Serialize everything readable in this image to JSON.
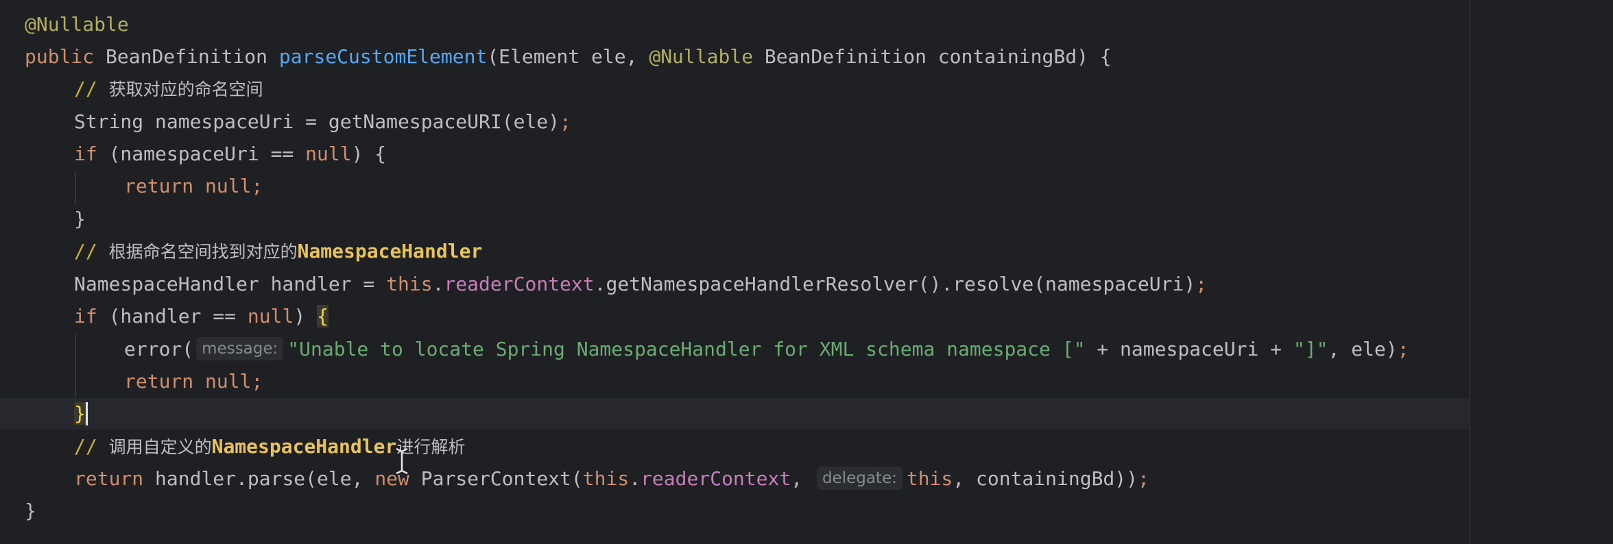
{
  "editor": {
    "lines": [
      {
        "id": "annotation",
        "segments": [
          {
            "t": "@Nullable",
            "c": "ann"
          }
        ]
      },
      {
        "id": "method-signature",
        "segments": [
          {
            "t": "public ",
            "c": "kw"
          },
          {
            "t": "BeanDefinition ",
            "c": ""
          },
          {
            "t": "parseCustomElement",
            "c": "fn"
          },
          {
            "t": "(Element ele, ",
            "c": ""
          },
          {
            "t": "@Nullable ",
            "c": "ann"
          },
          {
            "t": "BeanDefinition containingBd) {",
            "c": ""
          }
        ]
      },
      {
        "id": "comment-get-namespace",
        "segments": [
          {
            "t": "// ",
            "c": "cmt-mark"
          },
          {
            "t": "获取对应的命名空间",
            "c": "cmt-txt"
          }
        ]
      },
      {
        "id": "namespace-uri-decl",
        "segments": [
          {
            "t": "String namespaceUri = getNamespaceURI(ele)",
            "c": ""
          },
          {
            "t": ";",
            "c": "kw"
          }
        ]
      },
      {
        "id": "if-namespace-null",
        "segments": [
          {
            "t": "if ",
            "c": "kw"
          },
          {
            "t": "(namespaceUri == ",
            "c": ""
          },
          {
            "t": "null",
            "c": "kw"
          },
          {
            "t": ") {",
            "c": ""
          }
        ]
      },
      {
        "id": "return-null-1",
        "segments": [
          {
            "t": "return null;",
            "c": "kw"
          }
        ]
      },
      {
        "id": "close-brace-1",
        "segments": [
          {
            "t": "}",
            "c": ""
          }
        ]
      },
      {
        "id": "comment-find-handler",
        "segments": [
          {
            "t": "// ",
            "c": "cmt-mark"
          },
          {
            "t": "根据命名空间找到对应的",
            "c": "cmt-txt"
          },
          {
            "t": "NamespaceHandler",
            "c": "cmt-bold"
          }
        ]
      },
      {
        "id": "handler-decl",
        "segments": [
          {
            "t": "NamespaceHandler handler = ",
            "c": ""
          },
          {
            "t": "this",
            "c": "kw"
          },
          {
            "t": ".",
            "c": ""
          },
          {
            "t": "readerContext",
            "c": "fld"
          },
          {
            "t": ".getNamespaceHandlerResolver().resolve(namespaceUri)",
            "c": ""
          },
          {
            "t": ";",
            "c": "kw"
          }
        ]
      },
      {
        "id": "if-handler-null",
        "segments": [
          {
            "t": "if ",
            "c": "kw"
          },
          {
            "t": "(handler == ",
            "c": ""
          },
          {
            "t": "null",
            "c": "kw"
          },
          {
            "t": ") ",
            "c": ""
          },
          {
            "t": "{",
            "c": "brace-hl"
          }
        ]
      },
      {
        "id": "error-call",
        "segments": [
          {
            "t": "error(",
            "c": ""
          },
          {
            "hint": "message:"
          },
          {
            "t": "\"Unable to locate Spring NamespaceHandler for XML schema namespace [\"",
            "c": "str"
          },
          {
            "t": " + namespaceUri + ",
            "c": ""
          },
          {
            "t": "\"]\"",
            "c": "str"
          },
          {
            "t": ", ele)",
            "c": ""
          },
          {
            "t": ";",
            "c": "kw"
          }
        ]
      },
      {
        "id": "return-null-2",
        "segments": [
          {
            "t": "return null;",
            "c": "kw"
          }
        ]
      },
      {
        "id": "close-brace-2",
        "segments": [
          {
            "t": "}",
            "c": "brace-hl"
          },
          {
            "caret": true
          }
        ]
      },
      {
        "id": "comment-call-handler",
        "segments": [
          {
            "t": "// ",
            "c": "cmt-mark"
          },
          {
            "t": "调用自定义的",
            "c": "cmt-txt"
          },
          {
            "t": "NamespaceHandler",
            "c": "cmt-bold"
          },
          {
            "t": "进行解析",
            "c": "cmt-txt"
          }
        ]
      },
      {
        "id": "return-parse",
        "segments": [
          {
            "t": "return ",
            "c": "kw"
          },
          {
            "t": "handler.parse(ele, ",
            "c": ""
          },
          {
            "t": "new ",
            "c": "kw"
          },
          {
            "t": "ParserContext(",
            "c": ""
          },
          {
            "t": "this",
            "c": "kw"
          },
          {
            "t": ".",
            "c": ""
          },
          {
            "t": "readerContext",
            "c": "fld"
          },
          {
            "t": ", ",
            "c": ""
          },
          {
            "hint": "delegate:"
          },
          {
            "t": "this",
            "c": "kw"
          },
          {
            "t": ", containingBd))",
            "c": ""
          },
          {
            "t": ";",
            "c": "kw"
          }
        ]
      },
      {
        "id": "method-close-brace",
        "segments": [
          {
            "t": "}",
            "c": ""
          }
        ]
      }
    ]
  },
  "colors": {
    "background": "#1f2023",
    "keyword": "#cf8e6d",
    "annotation": "#b3ae60",
    "method": "#56a8f5",
    "field": "#c77dbb",
    "string": "#6aab73"
  }
}
